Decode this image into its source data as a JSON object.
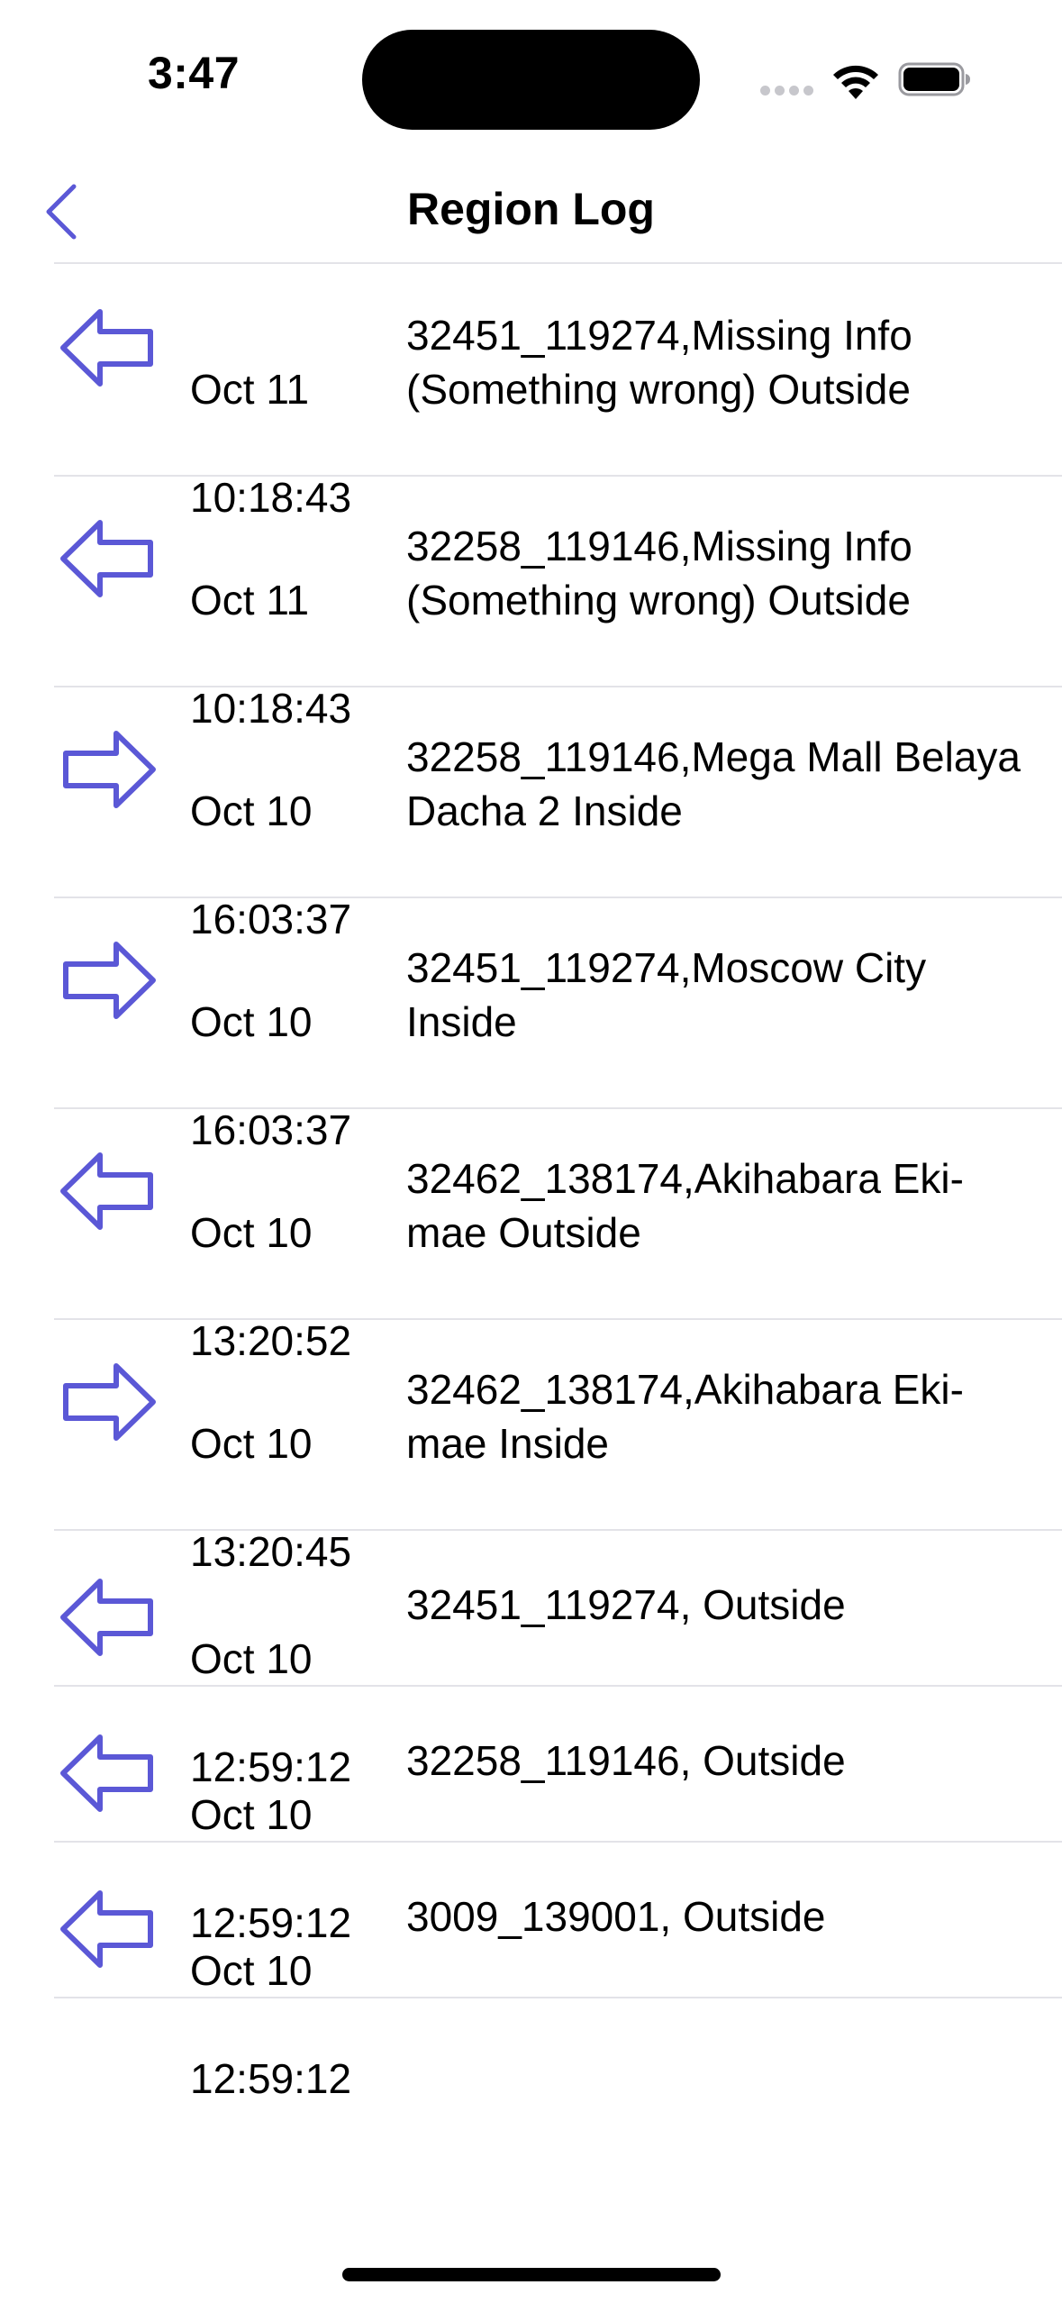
{
  "status_bar": {
    "time": "3:47"
  },
  "nav": {
    "title": "Region Log",
    "back_icon": "chevron-left-icon"
  },
  "colors": {
    "accent": "#5b58d6",
    "divider": "#e3e3e8",
    "text": "#000000"
  },
  "rows": [
    {
      "direction": "exit",
      "date": "Oct 11",
      "time": "10:18:43",
      "text": "32451_119274,Missing Info (Something wrong) Outside"
    },
    {
      "direction": "exit",
      "date": "Oct 11",
      "time": "10:18:43",
      "text": "32258_119146,Missing Info (Something wrong) Outside"
    },
    {
      "direction": "enter",
      "date": "Oct 10",
      "time": "16:03:37",
      "text": "32258_119146,Mega Mall Belaya Dacha 2 Inside"
    },
    {
      "direction": "enter",
      "date": "Oct 10",
      "time": "16:03:37",
      "text": "32451_119274,Moscow City Inside"
    },
    {
      "direction": "exit",
      "date": "Oct 10",
      "time": "13:20:52",
      "text": "32462_138174,Akihabara Eki-mae Outside"
    },
    {
      "direction": "enter",
      "date": "Oct 10",
      "time": "13:20:45",
      "text": "32462_138174,Akihabara Eki-mae Inside"
    },
    {
      "direction": "exit",
      "date": "Oct 10",
      "time": "12:59:12",
      "text": "32451_119274, Outside"
    },
    {
      "direction": "exit",
      "date": "Oct 10",
      "time": "12:59:12",
      "text": "32258_119146, Outside"
    },
    {
      "direction": "exit",
      "date": "Oct 10",
      "time": "12:59:12",
      "text": "3009_139001, Outside"
    }
  ]
}
